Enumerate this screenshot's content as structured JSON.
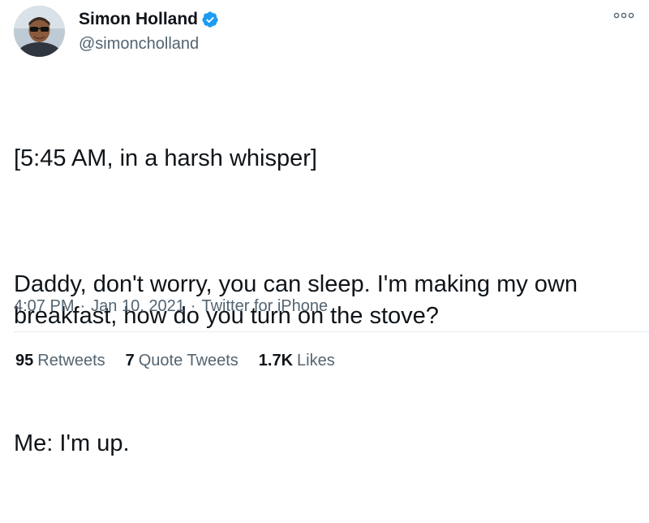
{
  "author": {
    "display_name": "Simon Holland",
    "handle": "@simoncholland",
    "verified": true,
    "avatar_icon": "user-avatar-photo",
    "verified_icon": "verified-badge-icon",
    "verified_color": "#1d9bf0"
  },
  "more_icon": "more-horizontal-icon",
  "tweet": {
    "line1": "[5:45 AM, in a harsh whisper]",
    "line2": "Daddy, don't worry, you can sleep. I'm making my own breakfast, how do you turn on the stove?",
    "line3": "Me: I'm up."
  },
  "meta": {
    "time": "4:07 PM",
    "separator": "·",
    "date": "Jan 10, 2021",
    "source": "Twitter for iPhone"
  },
  "stats": {
    "retweets_count": "95",
    "retweets_label": "Retweets",
    "quotes_count": "7",
    "quotes_label": "Quote Tweets",
    "likes_count": "1.7K",
    "likes_label": "Likes"
  },
  "colors": {
    "text_primary": "#0f1419",
    "text_secondary": "#536471",
    "divider": "#e6ecf0"
  }
}
